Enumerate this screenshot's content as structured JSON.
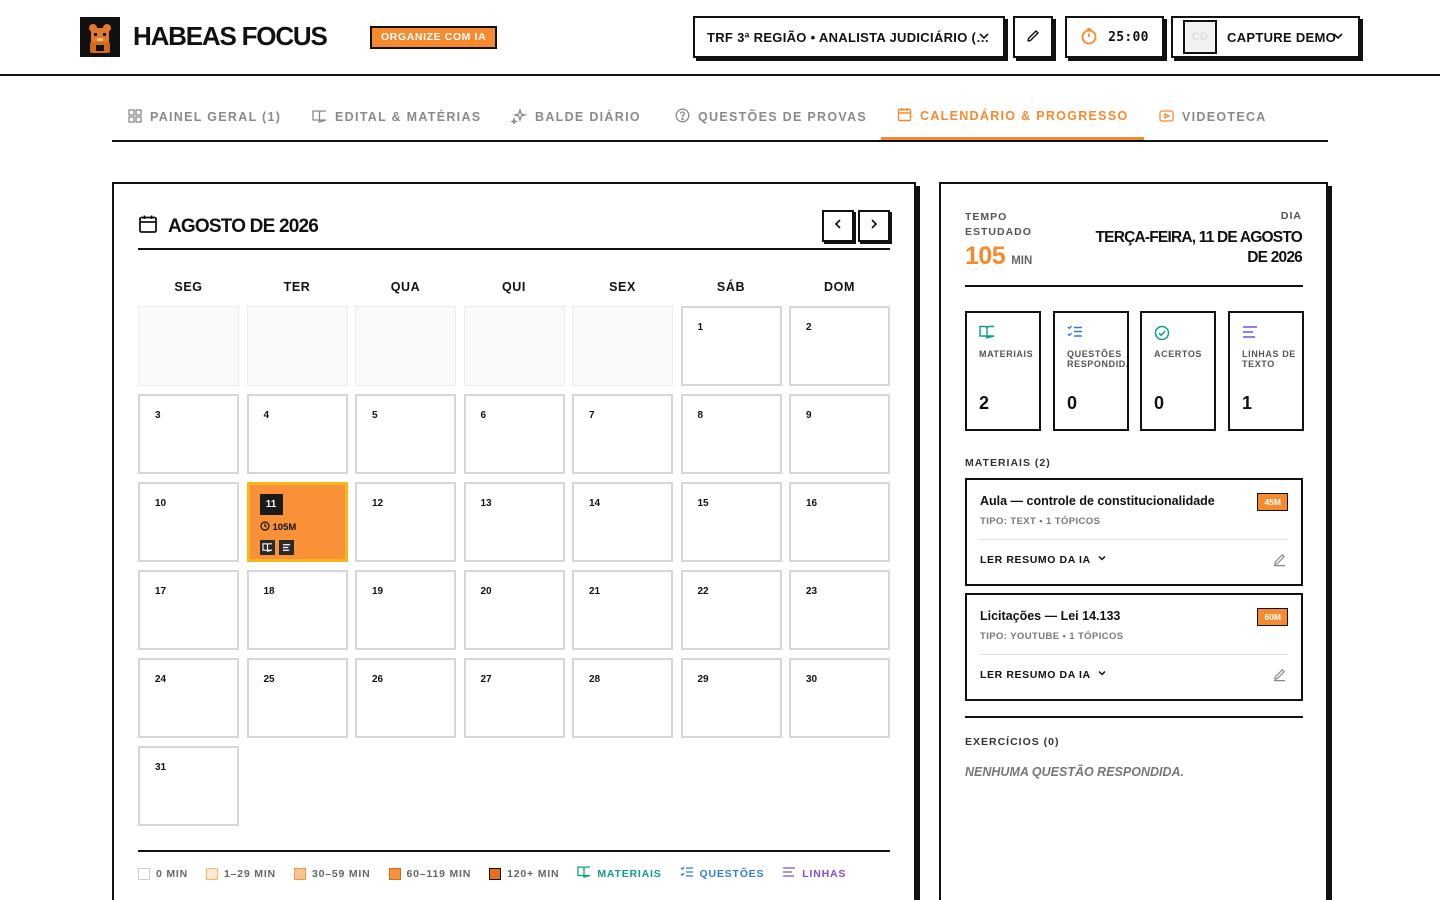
{
  "app": {
    "brand": "HABEAS FOCUS",
    "ai_badge": "ORGANIZE COM IA",
    "concurso": "TRF 3ª REGIÃO • ANALISTA JUDICIÁRIO (…",
    "timer": "25:00",
    "user_name": "CAPTURE DEMO",
    "user_initials": "CD",
    "logo_icon": "bear-mascot-icon"
  },
  "colors": {
    "accent": "#f58a2e",
    "highlight_border": "#f4b81c",
    "materiais": "#0f9d8a",
    "questoes": "#2f7fd1",
    "linhas": "#7c4ddb",
    "acertos": "#0f9d8a"
  },
  "tabs": [
    {
      "label": "PAINEL GERAL (1)",
      "icon": "grid-icon",
      "active": false
    },
    {
      "label": "EDITAL & MATÉRIAS",
      "icon": "book-icon",
      "active": false
    },
    {
      "label": "BALDE DIÁRIO",
      "icon": "sparkles-icon",
      "active": false
    },
    {
      "label": "QUESTÕES DE PROVAS",
      "icon": "help-circle-icon",
      "active": false
    },
    {
      "label": "CALENDÁRIO & PROGRESSO",
      "icon": "calendar-icon",
      "active": true
    },
    {
      "label": "VIDEOTECA",
      "icon": "video-icon",
      "active": false
    }
  ],
  "calendar": {
    "month_title": "AGOSTO DE 2026",
    "weekdays": [
      "SEG",
      "TER",
      "QUA",
      "QUI",
      "SEX",
      "SÁB",
      "DOM"
    ],
    "leading_empty_days": 5,
    "days_in_month": 31,
    "highlighted_day": {
      "day": 11,
      "minutes": "105M"
    },
    "legend": [
      {
        "label": "0 MIN",
        "color": "#ffffff"
      },
      {
        "label": "1–29 MIN",
        "color": "#fdebd3"
      },
      {
        "label": "30–59 MIN",
        "color": "#fbc48d"
      },
      {
        "label": "60–119 MIN",
        "color": "#f99138"
      },
      {
        "label": "120+ MIN",
        "color": "#e8701a"
      }
    ],
    "legend_types": {
      "materiais": "MATERIAIS",
      "questoes": "QUESTÕES",
      "linhas": "LINHAS"
    }
  },
  "detail": {
    "tempo_label": "TEMPO ESTUDADO",
    "tempo_value": "105",
    "tempo_unit": "MIN",
    "dia_label": "DIA",
    "date": "TERÇA-FEIRA, 11 DE AGOSTO DE 2026",
    "stats": [
      {
        "label": "MATERIAIS",
        "value": "2",
        "icon": "book-open-icon"
      },
      {
        "label": "QUESTÕES RESPONDIDAS",
        "value": "0",
        "icon": "list-check-icon"
      },
      {
        "label": "ACERTOS",
        "value": "0",
        "icon": "check-circle-icon"
      },
      {
        "label": "LINHAS DE TEXTO",
        "value": "1",
        "icon": "text-lines-icon"
      }
    ],
    "materiais_title": "MATERIAIS (2)",
    "materiais": [
      {
        "title": "Aula — controle de constitucionalidade",
        "tag": "45M",
        "type": "TIPO: TEXT • 1 TÓPICOS",
        "action": "LER RESUMO DA IA"
      },
      {
        "title": "Licitações — Lei 14.133",
        "tag": "60M",
        "type": "TIPO: YOUTUBE • 1 TÓPICOS",
        "action": "LER RESUMO DA IA"
      }
    ],
    "exercicios_title": "EXERCÍCIOS (0)",
    "exercicios_empty": "NENHUMA QUESTÃO RESPONDIDA."
  }
}
